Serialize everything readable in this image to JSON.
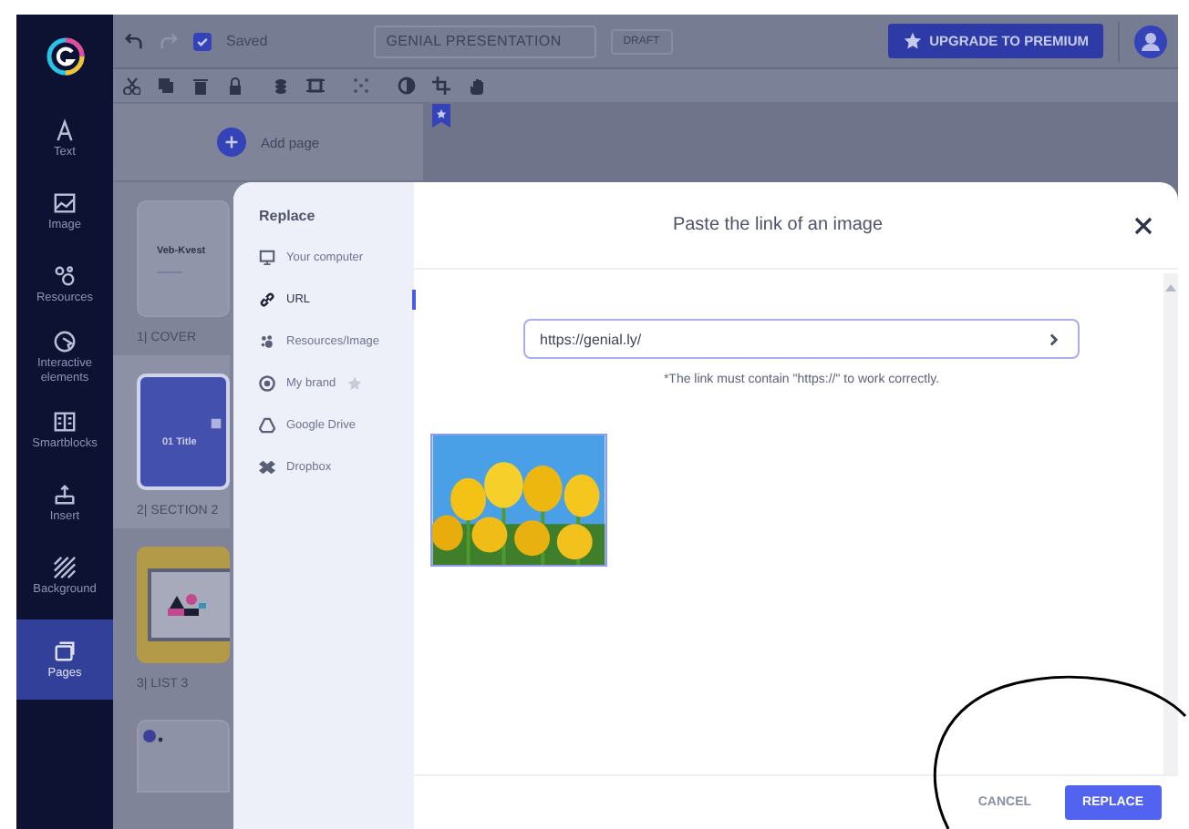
{
  "sidebar": {
    "items": [
      {
        "label": "Text",
        "selected": false
      },
      {
        "label": "Image",
        "selected": false
      },
      {
        "label": "Resources",
        "selected": false
      },
      {
        "label": "Interactive elements",
        "selected": false
      },
      {
        "label": "Smartblocks",
        "selected": false
      },
      {
        "label": "Insert",
        "selected": false
      },
      {
        "label": "Background",
        "selected": false
      },
      {
        "label": "Pages",
        "selected": true
      }
    ]
  },
  "topbar": {
    "saved": true,
    "status": "Saved",
    "title": "GENIAL PRESENTATION",
    "badge": "DRAFT",
    "upgrade_button": "UPGRADE TO PREMIUM"
  },
  "pages_panel": {
    "add_button": "Add page",
    "pages": [
      {
        "kind": "cover",
        "card_text": "Veb-Kvest",
        "label": "1| COVER",
        "selected": false
      },
      {
        "kind": "section",
        "card_text": "01 Title",
        "label": "2| SECTION 2",
        "selected": true
      },
      {
        "kind": "list",
        "label": "3| LIST 3",
        "selected": false
      },
      {
        "kind": "partial",
        "selected": false
      }
    ]
  },
  "modal": {
    "nav_title": "Replace",
    "nav_items": [
      {
        "label": "Your computer",
        "selected": false,
        "premium": false
      },
      {
        "label": "URL",
        "selected": true,
        "premium": false
      },
      {
        "label": "Resources/Image",
        "selected": false,
        "premium": false
      },
      {
        "label": "My brand",
        "selected": false,
        "premium": true
      },
      {
        "label": "Google Drive",
        "selected": false,
        "premium": false
      },
      {
        "label": "Dropbox",
        "selected": false,
        "premium": false
      }
    ],
    "title": "Paste the link of an image",
    "url_field": {
      "value": "https://genial.ly/"
    },
    "hint": "*The link must contain \"https://\" to work correctly.",
    "buttons": [
      {
        "label": "CANCEL",
        "kind": "text"
      },
      {
        "label": "REPLACE",
        "kind": "primary"
      }
    ]
  },
  "annotations": [
    {
      "kind": "ellipse"
    }
  ]
}
